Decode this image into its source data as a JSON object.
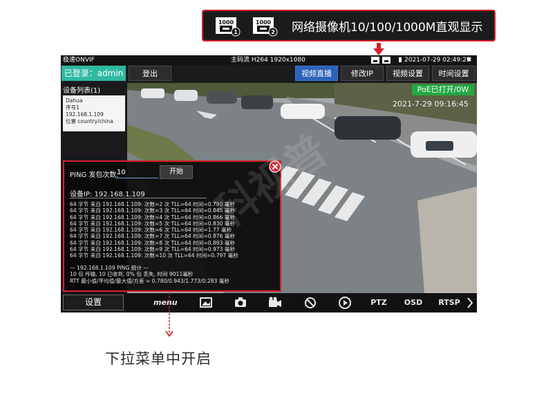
{
  "callout": {
    "ports": [
      {
        "label": "1000",
        "badge": "1"
      },
      {
        "label": "1000",
        "badge": "2"
      }
    ],
    "text": "网络摄像机10/100/1000M直观显示",
    "accent": "#d7202a"
  },
  "statusbar": {
    "app_name": "极速ONVIF",
    "stream_info": "主码流 H264 1920x1080",
    "datetime": "2021-07-29 02:49:29",
    "close_symbol": "✖"
  },
  "toolbar": {
    "login": "已登录：admin",
    "logout": "登出",
    "tabs": [
      {
        "label": "视频直播",
        "active": true
      },
      {
        "label": "修改IP",
        "active": false
      },
      {
        "label": "视频设置",
        "active": false
      },
      {
        "label": "时间设置",
        "active": false
      }
    ]
  },
  "sidebar": {
    "title": "设备列表(1)",
    "device": {
      "brand": "Dahua",
      "serial": "序号1",
      "ip": "192.168.1.109",
      "location": "位置 country/china"
    }
  },
  "video": {
    "poe_status": "PoE已打开/0W",
    "osd_time": "2021-7-29 09:16:45",
    "watermark": "科视普"
  },
  "ping": {
    "label": "PING  发包次数:",
    "count_value": "10",
    "start_button": "开始",
    "device_ip": "设备IP: 192.168.1.109",
    "lines": [
      "64 字节 来自 192.168.1.109: 次数=2 次 TLL=64 时间=0.780 毫秒",
      "64 字节 来自 192.168.1.109: 次数=3 次 TLL=64 时间=0.845 毫秒",
      "64 字节 来自 192.168.1.109: 次数=4 次 TLL=64 时间=0.866 毫秒",
      "64 字节 来自 192.168.1.109: 次数=5 次 TLL=64 时间=0.830 毫秒",
      "64 字节 来自 192.168.1.109: 次数=6 次 TLL=64 时间=1.77 毫秒",
      "64 字节 来自 192.168.1.109: 次数=7 次 TLL=64 时间=0.876 毫秒",
      "64 字节 来自 192.168.1.109: 次数=8 次 TLL=64 时间=0.893 毫秒",
      "64 字节 来自 192.168.1.109: 次数=9 次 TLL=64 时间=0.973 毫秒",
      "64 字节 来自 192.168.1.109: 次数=10 次 TLL=64 时间=0.797 毫秒"
    ],
    "stats": [
      "— 192.168.1.109 PING 统计 —",
      "10 包 传输, 10 已收到, 0% 包 丢失, 时间 9011毫秒",
      "RTT 最小值/平均值/最大值/方差 = 0.780/0.943/1.773/0.283 毫秒"
    ]
  },
  "bottombar": {
    "settings": "设置",
    "icons": [
      {
        "name": "menu-icon",
        "text": "menu"
      },
      {
        "name": "image-icon",
        "text": ""
      },
      {
        "name": "camera-icon",
        "text": ""
      },
      {
        "name": "video-record-icon",
        "text": ""
      },
      {
        "name": "mute-icon",
        "text": ""
      },
      {
        "name": "play-icon",
        "text": ""
      },
      {
        "name": "ptz-icon",
        "text": "PTZ"
      },
      {
        "name": "osd-icon",
        "text": "OSD"
      },
      {
        "name": "rtsp-icon",
        "text": "RTSP"
      },
      {
        "name": "next-icon",
        "text": ""
      }
    ]
  },
  "caption": "下拉菜单中开启"
}
